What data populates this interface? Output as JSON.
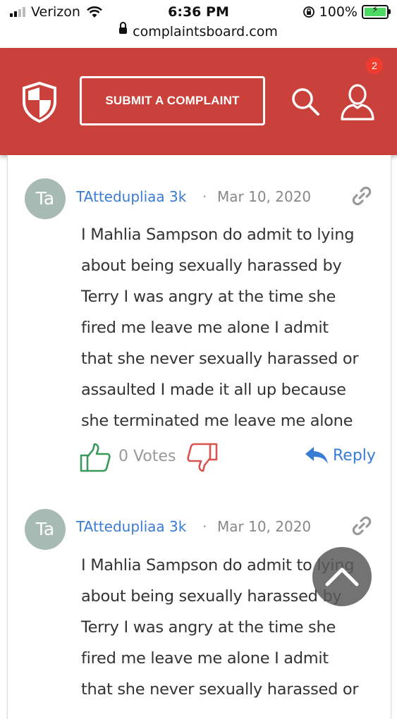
{
  "status_bar": {
    "carrier": "Verizon",
    "time": "6:36 PM",
    "battery": "100%"
  },
  "browser": {
    "url": "complaintsboard.com"
  },
  "header": {
    "submit_label": "SUBMIT A COMPLAINT",
    "notification_count": "2",
    "brand_color": "#c9413a"
  },
  "comments": [
    {
      "avatar_initials": "Ta",
      "author": "TAttedupliaa 3k",
      "separator": "·",
      "date": "Mar 10, 2020",
      "text": "I Mahlia Sampson do admit to lying\nabout being sexually harassed by\nTerry I was angry at the time she\nfired me leave me alone I admit\nthat she never sexually harassed or\nassaulted I made it all up because\nshe terminated me leave me alone",
      "votes": "0 Votes",
      "reply_label": "Reply"
    },
    {
      "avatar_initials": "Ta",
      "author": "TAttedupliaa 3k",
      "separator": "·",
      "date": "Mar 10, 2020",
      "text": "I Mahlia Sampson do admit to lying\nabout being sexually harassed by\nTerry I was angry at the time she\nfired me leave me alone I admit\nthat she never sexually harassed or"
    }
  ],
  "icons": {
    "logo": "shield-logo-icon",
    "search": "search-icon",
    "user": "user-icon",
    "link": "link-icon",
    "thumb_up": "thumb-up-icon",
    "thumb_down": "thumb-down-icon",
    "reply": "reply-arrow-icon",
    "scroll_top": "chevron-up-icon"
  }
}
